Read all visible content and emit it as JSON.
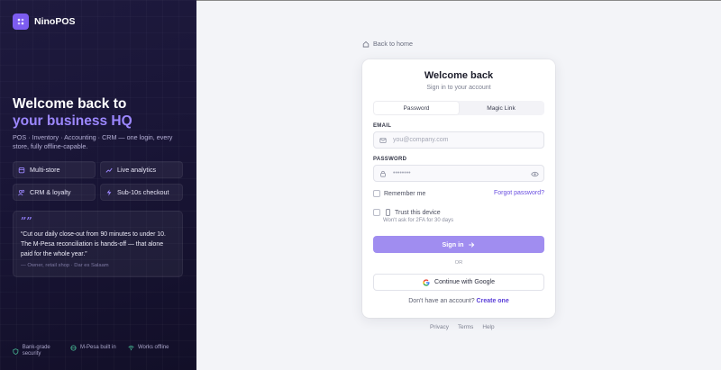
{
  "brand": {
    "name": "NinoPOS",
    "icon": "pos-logo-icon",
    "color": "#7c5cf0"
  },
  "hero": {
    "line1": "Welcome back to",
    "line2": "your business HQ",
    "accent_color": "#9c87ff",
    "tagline": "POS · Inventory · Accounting · CRM — one login, every store, fully offline-capable."
  },
  "features": [
    {
      "label": "Multi-store",
      "icon": "store-icon"
    },
    {
      "label": "Live analytics",
      "icon": "chart-icon"
    },
    {
      "label": "CRM & loyalty",
      "icon": "users-icon"
    },
    {
      "label": "Sub-10s checkout",
      "icon": "bolt-icon"
    }
  ],
  "testimonial": {
    "mark": "””",
    "text": "“Cut our daily close-out from 90 minutes to under 10. The M-Pesa reconciliation is hands-off — that alone paid for the whole year.”",
    "author": "— Owner, retail shop · Dar es Salaam"
  },
  "footer_badges": [
    {
      "label": "Bank-grade security",
      "icon": "shield-icon"
    },
    {
      "label": "M-Pesa built in",
      "icon": "globe-icon"
    },
    {
      "label": "Works offline",
      "icon": "wifi-icon"
    }
  ],
  "back_link": "Back to home",
  "card": {
    "title": "Welcome back",
    "subtitle": "Sign in to your account",
    "tabs": [
      {
        "label": "Password",
        "active": true
      },
      {
        "label": "Magic Link",
        "active": false
      }
    ],
    "email": {
      "label": "EMAIL",
      "placeholder": "you@company.com"
    },
    "password": {
      "label": "PASSWORD",
      "placeholder": "••••••••"
    },
    "remember_label": "Remember me",
    "forgot_label": "Forgot password?",
    "trust_label": "Trust this device",
    "trust_sub": "Won't ask for 2FA for 30 days",
    "signin_label": "Sign in",
    "or_label": "OR",
    "google_label": "Continue with Google",
    "no_account": "Don't have an account?",
    "create_label": "Create one",
    "primary_color": "#a08df0"
  },
  "bottom_links": [
    "Privacy",
    "Terms",
    "Help"
  ]
}
